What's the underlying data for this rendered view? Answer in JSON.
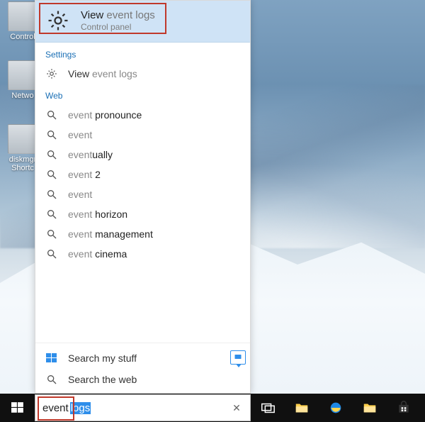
{
  "desktop": {
    "icons": [
      {
        "label": "Control"
      },
      {
        "label": "Netwo"
      },
      {
        "label": "diskmgr Shortc"
      }
    ]
  },
  "search": {
    "best_match": {
      "title_prefix": "View ",
      "title_query": "event logs",
      "subtitle": "Control panel"
    },
    "sections": {
      "settings_label": "Settings",
      "web_label": "Web"
    },
    "settings_results": [
      {
        "prefix": "View ",
        "query": "event logs"
      }
    ],
    "web_results": [
      {
        "query": "event",
        "suffix": "   pronounce"
      },
      {
        "query": "event",
        "suffix": ""
      },
      {
        "query": "event",
        "suffix": "ually"
      },
      {
        "query": "event",
        "suffix": " 2"
      },
      {
        "query": "event",
        "suffix": ""
      },
      {
        "query": "event",
        "suffix": " horizon"
      },
      {
        "query": "event",
        "suffix": " management"
      },
      {
        "query": "event",
        "suffix": " cinema"
      }
    ],
    "footer": {
      "my_stuff": "Search my stuff",
      "web": "Search the web"
    },
    "input": {
      "typed": "event",
      "selected_suffix": " logs",
      "clear_glyph": "✕"
    }
  },
  "taskbar": {
    "apps": [
      "task-view",
      "file-explorer",
      "internet-explorer",
      "file-explorer-2",
      "store"
    ]
  }
}
